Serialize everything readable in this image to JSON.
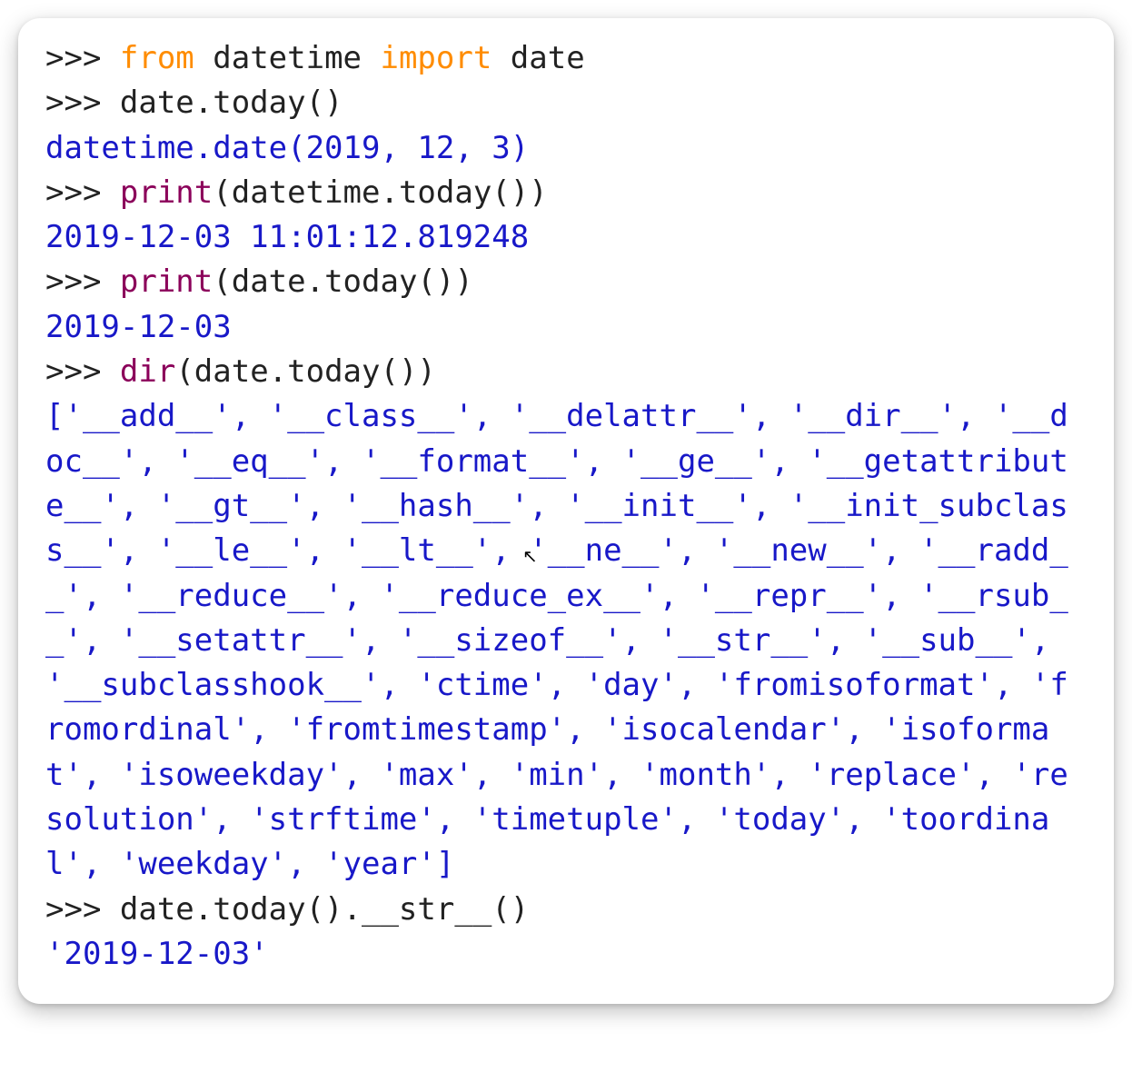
{
  "repl": {
    "prompt": ">>> ",
    "lines": {
      "l1_from": "from",
      "l1_mid": " datetime ",
      "l1_import": "import",
      "l1_rest": " date",
      "l2": "date.today()",
      "l2_out": "datetime.date(2019, 12, 3)",
      "l3_func": "print",
      "l3_rest": "(datetime.today())",
      "l3_out": "2019-12-03 11:01:12.819248",
      "l4_func": "print",
      "l4_rest": "(date.today())",
      "l4_out": "2019-12-03",
      "l5_func": "dir",
      "l5_rest": "(date.today())",
      "l5_out": "['__add__', '__class__', '__delattr__', '__dir__', '__doc__', '__eq__', '__format__', '__ge__', '__getattribute__', '__gt__', '__hash__', '__init__', '__init_subclass__', '__le__', '__lt__', '__ne__', '__new__', '__radd__', '__reduce__', '__reduce_ex__', '__repr__', '__rsub__', '__setattr__', '__sizeof__', '__str__', '__sub__', '__subclasshook__', 'ctime', 'day', 'fromisoformat', 'fromordinal', 'fromtimestamp', 'isocalendar', 'isoformat', 'isoweekday', 'max', 'min', 'month', 'replace', 'resolution', 'strftime', 'timetuple', 'today', 'toordinal', 'weekday', 'year']",
      "l6": "date.today().__str__()",
      "l6_out": "'2019-12-03'"
    }
  }
}
